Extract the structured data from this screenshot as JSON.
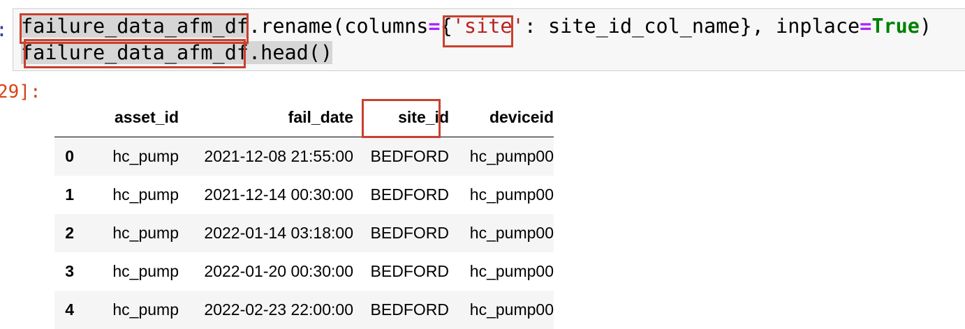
{
  "input_cell": {
    "prompt": ":",
    "code": {
      "line1": {
        "var": "failure_data_afm_df",
        "method": ".rename(columns",
        "eq1": "=",
        "brace_open": "{",
        "key": "'site'",
        "middle": ": site_id_col_name}, inplace",
        "eq2": "=",
        "true_kw": "True",
        "close": ")"
      },
      "line2": {
        "var": "failure_data_afm_df",
        "method": ".head()"
      }
    }
  },
  "output_cell": {
    "prompt": "29]:",
    "table": {
      "columns": [
        "asset_id",
        "fail_date",
        "site_id",
        "deviceid"
      ],
      "rows": [
        {
          "index": "0",
          "cells": [
            "hc_pump",
            "2021-12-08 21:55:00",
            "BEDFORD",
            "hc_pump00"
          ]
        },
        {
          "index": "1",
          "cells": [
            "hc_pump",
            "2021-12-14 00:30:00",
            "BEDFORD",
            "hc_pump00"
          ]
        },
        {
          "index": "2",
          "cells": [
            "hc_pump",
            "2022-01-14 03:18:00",
            "BEDFORD",
            "hc_pump00"
          ]
        },
        {
          "index": "3",
          "cells": [
            "hc_pump",
            "2022-01-20 00:30:00",
            "BEDFORD",
            "hc_pump00"
          ]
        },
        {
          "index": "4",
          "cells": [
            "hc_pump",
            "2022-02-23 22:00:00",
            "BEDFORD",
            "hc_pump00"
          ]
        }
      ]
    }
  },
  "colors": {
    "annotation_box": "#c8402e",
    "input_bg": "#f7f7f7",
    "out_prompt": "#d84315",
    "string": "#ba2121",
    "operator": "#aa22ff",
    "keyword": "#008000"
  }
}
